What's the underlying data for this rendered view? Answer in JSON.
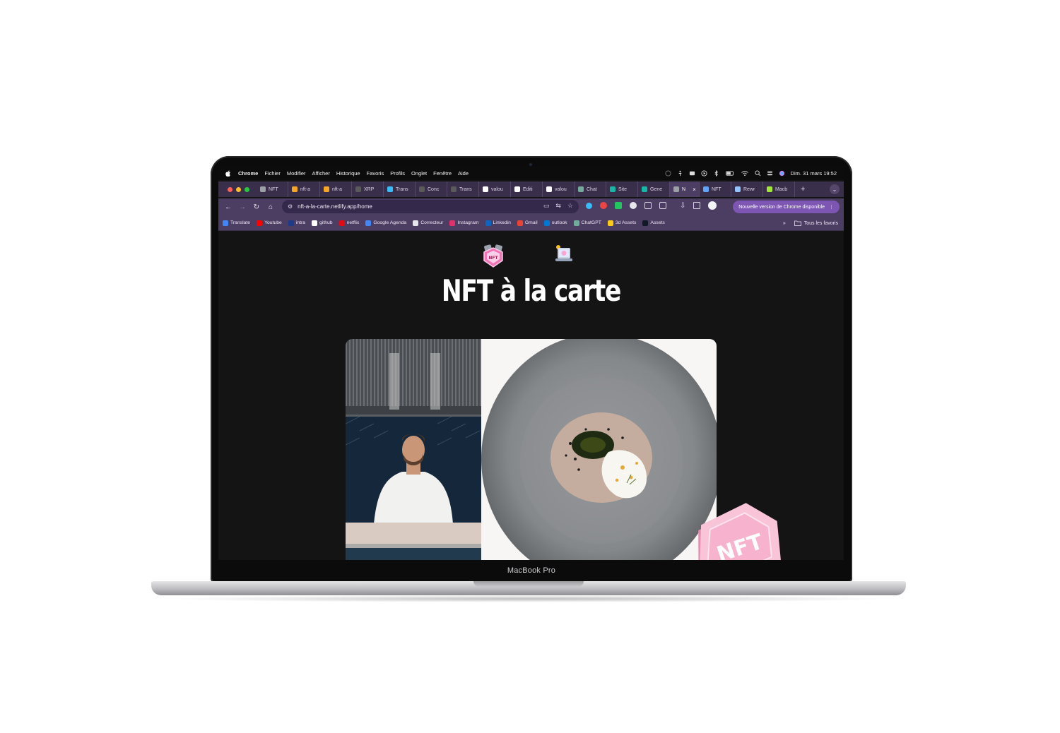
{
  "device": {
    "chin_label": "MacBook Pro"
  },
  "menubar": {
    "items": [
      "Chrome",
      "Fichier",
      "Modifier",
      "Afficher",
      "Historique",
      "Favoris",
      "Profils",
      "Onglet",
      "Fenêtre",
      "Aide"
    ],
    "clock": "Dim. 31 mars  19:52"
  },
  "tabs": [
    {
      "label": "NFT",
      "color": "#9aa0a6"
    },
    {
      "label": "nft-a",
      "color": "#f5a623"
    },
    {
      "label": "nft-a",
      "color": "#f5a623"
    },
    {
      "label": "XRP",
      "color": "#5a5a5a"
    },
    {
      "label": "Trans",
      "color": "#38bdf8"
    },
    {
      "label": "Conc",
      "color": "#5a5a5a"
    },
    {
      "label": "Trans",
      "color": "#5a5a5a"
    },
    {
      "label": "valou",
      "color": "#ffffff"
    },
    {
      "label": "Editi",
      "color": "#ffffff"
    },
    {
      "label": "valou",
      "color": "#ffffff"
    },
    {
      "label": "Chat",
      "color": "#74aa9c"
    },
    {
      "label": "Site",
      "color": "#14b8a6"
    },
    {
      "label": "Gene",
      "color": "#14b8a6"
    },
    {
      "label": "N",
      "color": "#9aa0a6",
      "active": true
    },
    {
      "label": "NFT",
      "color": "#60a5fa"
    },
    {
      "label": "Rewr",
      "color": "#93c5fd"
    },
    {
      "label": "Macb",
      "color": "#a3e635"
    }
  ],
  "toolbar": {
    "url": "nft-a-la-carte.netlify.app/home",
    "update_label": "Nouvelle version de Chrome disponible"
  },
  "bookmarks": [
    {
      "label": "Translate",
      "color": "#4285f4"
    },
    {
      "label": "Youtube",
      "color": "#ff0000"
    },
    {
      "label": "intra",
      "color": "#1e3a8a"
    },
    {
      "label": "github",
      "color": "#ffffff"
    },
    {
      "label": "netflix",
      "color": "#e50914"
    },
    {
      "label": "Google Agenda",
      "color": "#4285f4"
    },
    {
      "label": "Correcteur",
      "color": "#e5e7eb"
    },
    {
      "label": "Instagram",
      "color": "#e1306c"
    },
    {
      "label": "Linkedin",
      "color": "#0a66c2"
    },
    {
      "label": "Gmail",
      "color": "#ea4335"
    },
    {
      "label": "outlook",
      "color": "#0078d4"
    },
    {
      "label": "ChatGPT",
      "color": "#74aa9c"
    },
    {
      "label": "3d Assets",
      "color": "#facc15"
    },
    {
      "label": "Assets",
      "color": "#111827"
    }
  ],
  "bookmarks_more": "»",
  "bookmarks_all": "Tous les favoris",
  "page": {
    "title": "NFT à la carte",
    "badge_text": "NFT"
  }
}
